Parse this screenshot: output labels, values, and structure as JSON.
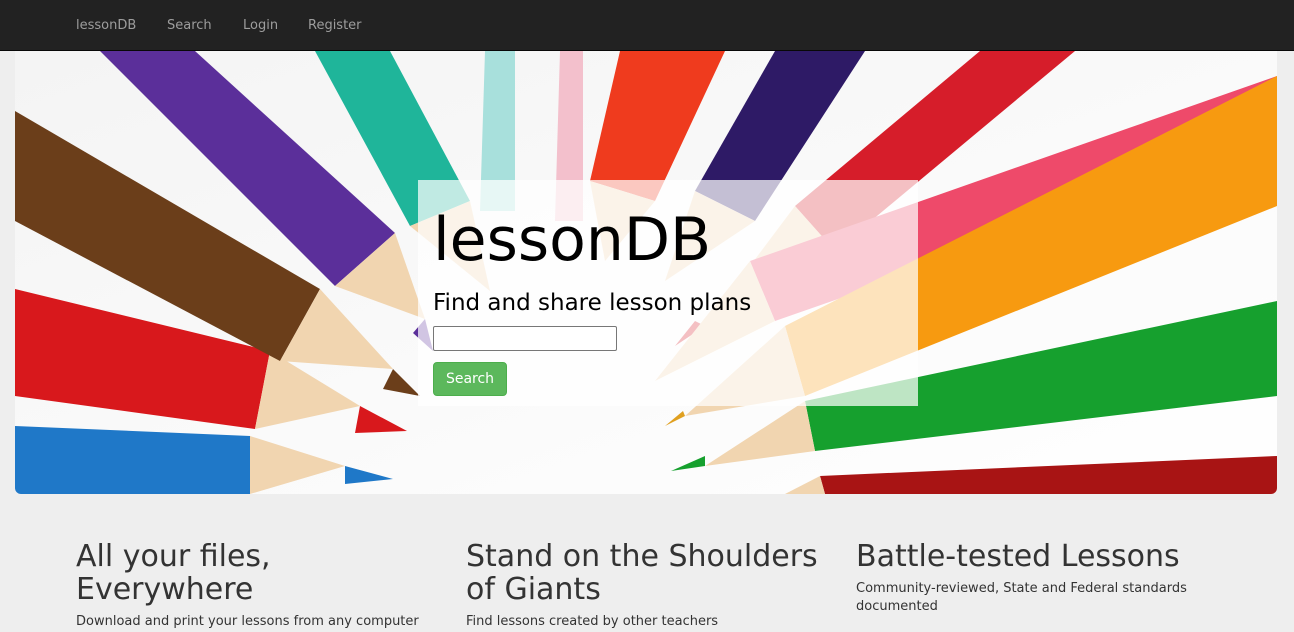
{
  "navbar": {
    "brand": "lessonDB",
    "links": [
      "Search",
      "Login",
      "Register"
    ]
  },
  "hero": {
    "image_description_icon": "colored-pencils-image",
    "title": "lessonDB",
    "subtitle": "Find and share lesson plans",
    "search_value": "",
    "search_button_label": "Search"
  },
  "features": [
    {
      "title": "All your files, Everywhere",
      "text": "Download and print your lessons from any computer"
    },
    {
      "title": "Stand on the Shoulders of Giants",
      "text": "Find lessons created by other teachers"
    },
    {
      "title": "Battle-tested Lessons",
      "text": "Community-reviewed, State and Federal standards documented"
    }
  ],
  "colors": {
    "navbar_bg": "#222222",
    "nav_link": "#9d9d9d",
    "page_bg": "#eeeeee",
    "search_button": "#5cb85c"
  }
}
